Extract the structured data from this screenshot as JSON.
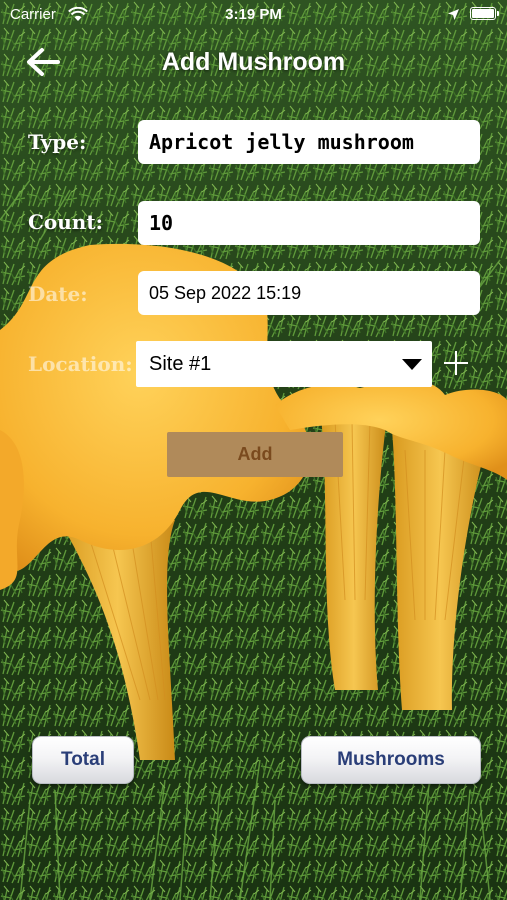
{
  "status_bar": {
    "carrier": "Carrier",
    "time": "3:19 PM"
  },
  "nav": {
    "title": "Add Mushroom",
    "back_icon": "arrow-left-icon"
  },
  "form": {
    "type_label": "Type:",
    "type_value": "Apricot jelly mushroom",
    "count_label": "Count:",
    "count_value": "10",
    "date_label": "Date:",
    "date_value": "05 Sep 2022 15:19",
    "location_label": "Location:",
    "location_value": "Site #1",
    "add_location_icon": "plus-icon",
    "add_button": "Add"
  },
  "bottom": {
    "total_button": "Total",
    "mushrooms_button": "Mushrooms"
  },
  "colors": {
    "moss": "#24461a",
    "chanterelle": "#f7b22e",
    "add_button_bg": "#b08a5a",
    "pill_text": "#2a3e78"
  }
}
